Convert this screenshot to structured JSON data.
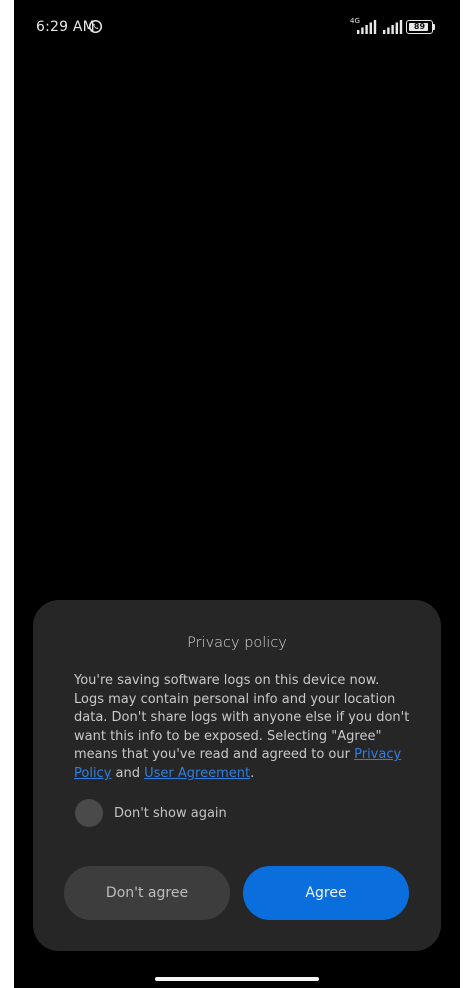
{
  "status_bar": {
    "time": "6:29 AM",
    "network_type": "4G",
    "battery": "89"
  },
  "dialog": {
    "title": "Privacy policy",
    "body": {
      "text_1": "You're saving software logs on this device now. Logs may contain personal info and your location data. Don't share logs with anyone else if you don't want this info to be exposed. Selecting \"Agree\" means that you've read and agreed to our ",
      "privacy_link": "Privacy Policy",
      "text_2": " and ",
      "agreement_link": "User Agreement",
      "text_3": "."
    },
    "checkbox_label": "Don't show again",
    "disagree_label": "Don't agree",
    "agree_label": "Agree"
  },
  "colors": {
    "background": "#000000",
    "dialog": "#262626",
    "agree": "#0a6fdd",
    "link": "#2f7fe0"
  },
  "icons": [
    "whatsapp-icon",
    "signal-icon",
    "battery-icon"
  ]
}
